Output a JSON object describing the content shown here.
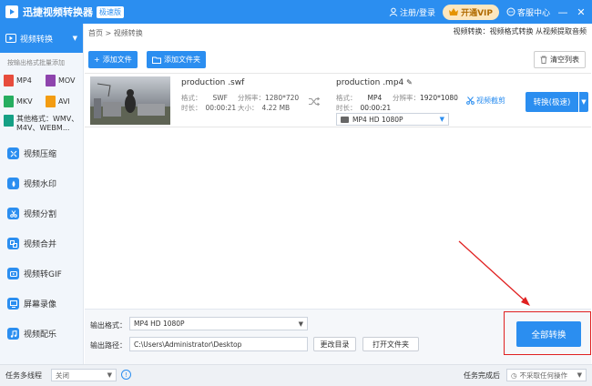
{
  "titlebar": {
    "app_title": "迅捷视频转换器",
    "edition_badge": "极速版",
    "login": "注册/登录",
    "vip": "开通VIP",
    "service": "客服中心",
    "min": "—",
    "close": "✕"
  },
  "sidebar": {
    "active_label": "视频转换",
    "hint": "按输出格式批量添加",
    "formats": [
      "MP4",
      "MOV",
      "MKV",
      "AVI"
    ],
    "other_formats": "其他格式：WMV、M4V、WEBM...",
    "items": [
      {
        "label": "视频压缩",
        "icon": "compress-icon"
      },
      {
        "label": "视频水印",
        "icon": "watermark-icon"
      },
      {
        "label": "视频分割",
        "icon": "split-icon"
      },
      {
        "label": "视频合并",
        "icon": "merge-icon"
      },
      {
        "label": "视频转GIF",
        "icon": "gif-icon"
      },
      {
        "label": "屏幕录像",
        "icon": "screen-record-icon"
      },
      {
        "label": "视频配乐",
        "icon": "music-icon"
      }
    ],
    "format_colors": [
      "#e74c3c",
      "#8e44ad",
      "#27ae60",
      "#f39c12"
    ]
  },
  "main": {
    "breadcrumb": "首页 > 视频转换",
    "crumb_hint": "视频转换：视频格式转换 从视频提取音频",
    "add_file": "添加文件",
    "add_folder": "添加文件夹",
    "clear_list": "清空列表"
  },
  "file": {
    "src_name": "production .swf",
    "src_format_label": "格式：",
    "src_format": "SWF",
    "src_res_label": "分辨率：",
    "src_res": "1280*720",
    "src_duration_label": "时长：",
    "src_duration": "00:00:21",
    "src_size_label": "大小：",
    "src_size": "4.22 MB",
    "dst_name": "production .mp4",
    "dst_format_label": "格式：",
    "dst_format": "MP4",
    "dst_res_label": "分辨率：",
    "dst_res": "1920*1080",
    "dst_duration_label": "时长：",
    "dst_duration": "00:00:21",
    "dst_select": "MP4   HD 1080P",
    "edit": "视频截剪",
    "convert": "转换(极速)"
  },
  "bottom": {
    "output_format_label": "输出格式：",
    "output_format": "MP4   HD 1080P",
    "output_path_label": "输出路径：",
    "output_path": "C:\\Users\\Administrator\\Desktop",
    "change_dir": "更改目录",
    "open_folder": "打开文件夹",
    "convert_all": "全部转换"
  },
  "status": {
    "multithread_label": "任务多线程",
    "multithread_value": "关闭",
    "after_label": "任务完成后",
    "after_value": "不采取任何操作"
  },
  "colors": {
    "accent": "#2b8ef0",
    "highlight_box": "#e02020"
  }
}
